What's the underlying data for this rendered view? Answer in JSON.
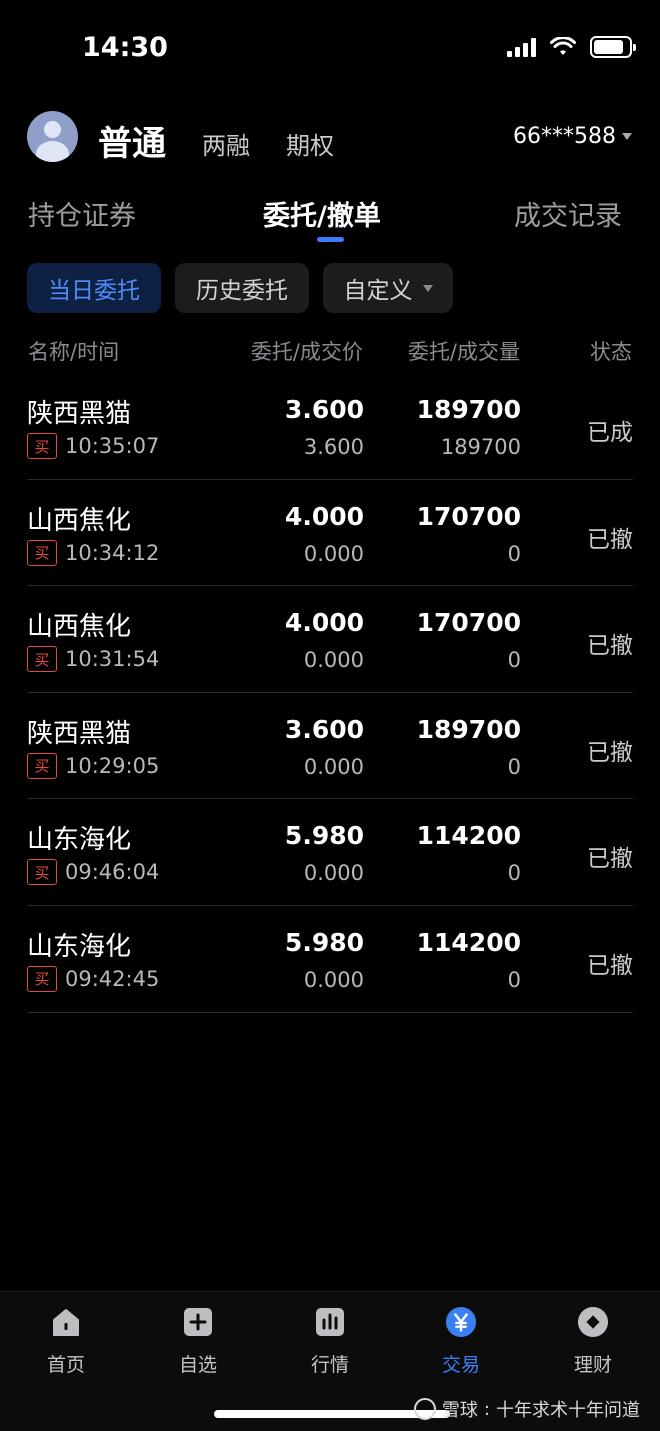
{
  "status_bar": {
    "time": "14:30"
  },
  "account": {
    "tabs": [
      "普通",
      "两融",
      "期权"
    ],
    "number": "66***588"
  },
  "main_tabs": [
    "持仓证券",
    "委托/撤单",
    "成交记录"
  ],
  "filters": [
    "当日委托",
    "历史委托",
    "自定义"
  ],
  "columns": {
    "name": "名称/时间",
    "price": "委托/成交价",
    "qty": "委托/成交量",
    "status": "状态"
  },
  "orders": [
    {
      "name": "陕西黑猫",
      "side": "买",
      "time": "10:35:07",
      "price": "3.600",
      "deal_price": "3.600",
      "qty": "189700",
      "deal_qty": "189700",
      "status": "已成"
    },
    {
      "name": "山西焦化",
      "side": "买",
      "time": "10:34:12",
      "price": "4.000",
      "deal_price": "0.000",
      "qty": "170700",
      "deal_qty": "0",
      "status": "已撤"
    },
    {
      "name": "山西焦化",
      "side": "买",
      "time": "10:31:54",
      "price": "4.000",
      "deal_price": "0.000",
      "qty": "170700",
      "deal_qty": "0",
      "status": "已撤"
    },
    {
      "name": "陕西黑猫",
      "side": "买",
      "time": "10:29:05",
      "price": "3.600",
      "deal_price": "0.000",
      "qty": "189700",
      "deal_qty": "0",
      "status": "已撤"
    },
    {
      "name": "山东海化",
      "side": "买",
      "time": "09:46:04",
      "price": "5.980",
      "deal_price": "0.000",
      "qty": "114200",
      "deal_qty": "0",
      "status": "已撤"
    },
    {
      "name": "山东海化",
      "side": "买",
      "time": "09:42:45",
      "price": "5.980",
      "deal_price": "0.000",
      "qty": "114200",
      "deal_qty": "0",
      "status": "已撤"
    }
  ],
  "bottom_nav": [
    {
      "label": "首页",
      "icon": "home-icon"
    },
    {
      "label": "自选",
      "icon": "add-watchlist-icon"
    },
    {
      "label": "行情",
      "icon": "market-chart-icon"
    },
    {
      "label": "交易",
      "icon": "yuan-trade-icon"
    },
    {
      "label": "理财",
      "icon": "wealth-icon"
    }
  ],
  "watermark": {
    "brand": "雪球",
    "text": "十年求术十年问道"
  },
  "colors": {
    "accent": "#3b7cf6",
    "buy": "#e5483d",
    "background": "#000000"
  }
}
